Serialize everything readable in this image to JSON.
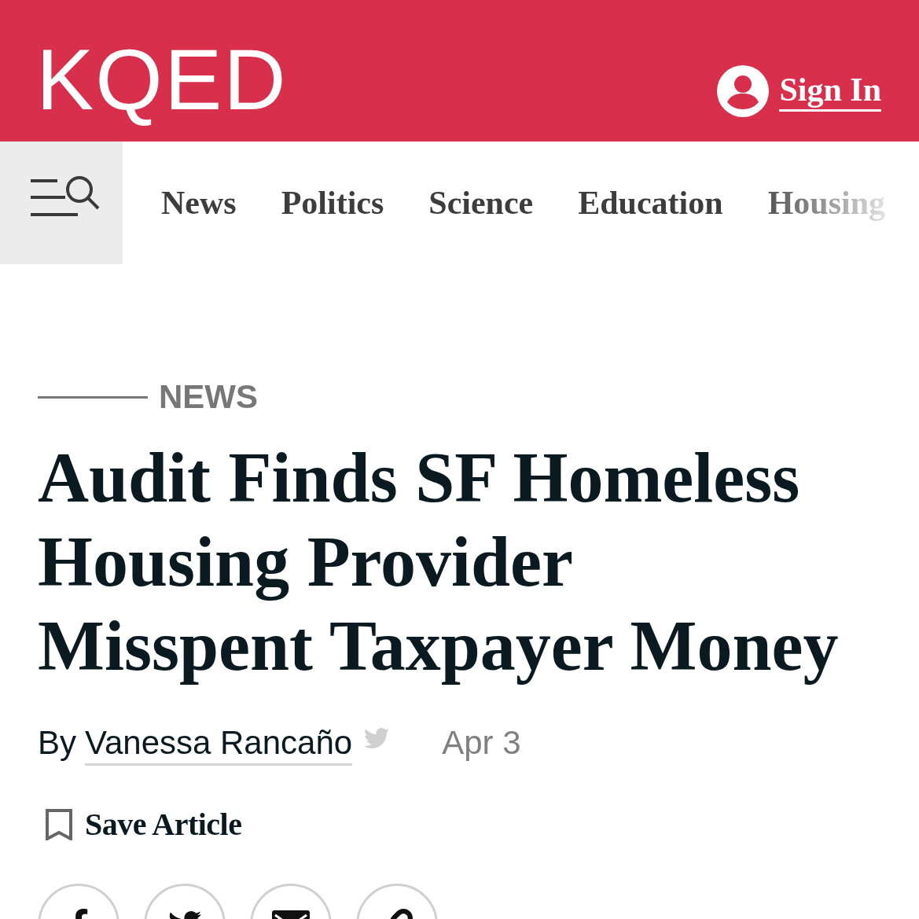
{
  "header": {
    "logo": "KQED",
    "sign_in": "Sign In"
  },
  "nav": {
    "items": [
      {
        "label": "News",
        "faded": false
      },
      {
        "label": "Politics",
        "faded": false
      },
      {
        "label": "Science",
        "faded": false
      },
      {
        "label": "Education",
        "faded": false
      },
      {
        "label": "Housing",
        "faded": true
      }
    ]
  },
  "article": {
    "section": "NEWS",
    "headline": "Audit Finds SF Homeless Housing Provider Misspent Taxpayer Money",
    "byline": {
      "prefix": "By",
      "author": "Vanessa Rancaño",
      "date": "Apr 3"
    },
    "save_label": "Save Article",
    "share_buttons": [
      {
        "kind": "facebook"
      },
      {
        "kind": "twitter"
      },
      {
        "kind": "email"
      },
      {
        "kind": "link"
      }
    ]
  }
}
